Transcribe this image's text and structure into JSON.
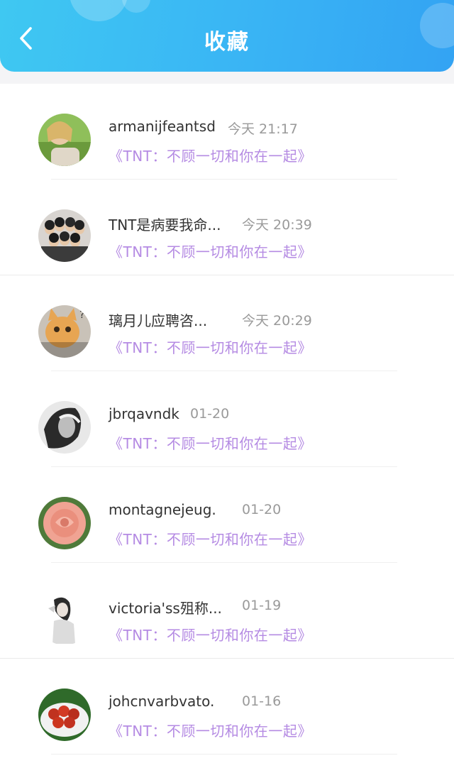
{
  "header": {
    "title": "收藏",
    "back_icon": "chevron-left-icon",
    "gradient_colors": [
      "#3fc8f2",
      "#33a3f3"
    ]
  },
  "accent_color": "#b58be3",
  "items": [
    {
      "name": "armanijfeantsd",
      "time": "今天 21:17",
      "collection": "《TNT：不顾一切和你在一起》",
      "avatar": "girl-photo"
    },
    {
      "name": "TNT是病要我命...",
      "time": "今天 20:39",
      "collection": "《TNT：不顾一切和你在一起》",
      "avatar": "group-photo"
    },
    {
      "name": "璃月儿应聘咨...",
      "time": "今天 20:29",
      "collection": "《TNT：不顾一切和你在一起》",
      "avatar": "cat-meme",
      "avatar_text": "这种话\n也说得出"
    },
    {
      "name": "jbrqavndk",
      "time": "01-20",
      "collection": "《TNT：不顾一切和你在一起》",
      "avatar": "bw-portrait"
    },
    {
      "name": "montagnejeug.",
      "time": "01-20",
      "collection": "《TNT：不顾一切和你在一起》",
      "avatar": "rose-photo"
    },
    {
      "name": "victoria'ss殂称...",
      "time": "01-19",
      "collection": "《TNT：不顾一切和你在一起》",
      "avatar": "woman-sketch"
    },
    {
      "name": "johcnvarbvato.",
      "time": "01-16",
      "collection": "《TNT：不顾一切和你在一起》",
      "avatar": "food-photo"
    }
  ]
}
